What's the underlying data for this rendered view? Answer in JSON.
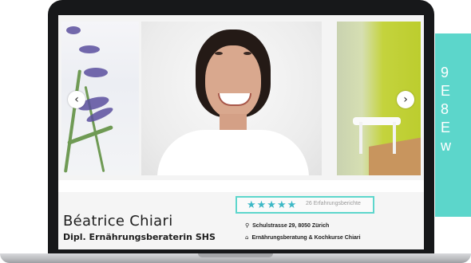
{
  "profile": {
    "name": "Béatrice Chiari",
    "title": "Dipl. Ernährungsberaterin SHS",
    "stars": "★★★★★",
    "rating": 5,
    "reviews": "26 Erfahrungsberichte",
    "address": "Schulstrasse 29, 8050 Zürich",
    "business": "Ernährungsberatung & Kochkurse Chiari"
  },
  "gallery": {
    "prev": "‹",
    "next": "›"
  },
  "icons": {
    "address": "map-pin-icon",
    "business": "home-icon"
  },
  "side_panel": {
    "lines": [
      "9",
      "E",
      "8",
      "E",
      "w"
    ]
  },
  "colors": {
    "accent": "#5cd6cb",
    "star": "#3db8c6",
    "laptop": "#17181a"
  }
}
